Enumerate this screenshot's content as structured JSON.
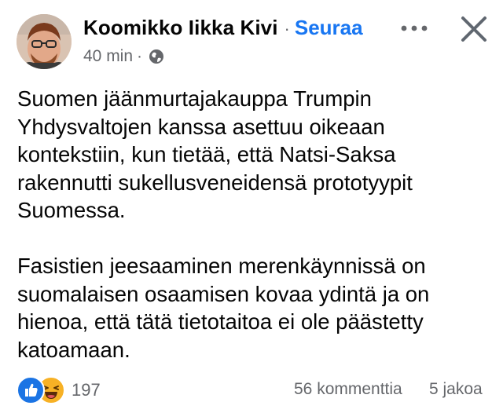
{
  "post": {
    "author": "Koomikko Iikka Kivi",
    "separator": "·",
    "follow_label": "Seuraa",
    "time": "40 min",
    "privacy_icon": "globe-icon",
    "paragraphs": [
      "Suomen jäänmurtajakauppa Trumpin Yhdysvaltojen kanssa asettuu oikeaan kontekstiin, kun tietää, että Natsi-Saksa rakennutti sukellusveneidensä prototyypit Suomessa.",
      "Fasistien jeesaaminen merenkäynnissä on suomalaisen osaamisen kovaa ydintä ja on hienoa, että tätä tietotaitoa ei ole päästetty katoamaan."
    ]
  },
  "footer": {
    "reaction_icons": [
      "like-icon",
      "haha-icon"
    ],
    "reaction_count": "197",
    "comments": "56 kommenttia",
    "shares": "5 jakoa"
  },
  "colors": {
    "accent": "#1876f2",
    "secondary_text": "#65676b",
    "like": "#1b74e4",
    "haha": "#f7b125"
  }
}
